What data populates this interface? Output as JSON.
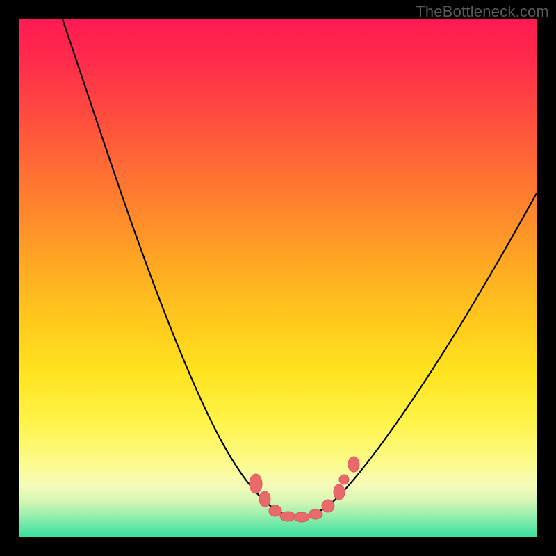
{
  "watermark": "TheBottleneck.com",
  "chart_data": {
    "type": "line",
    "title": "",
    "xlabel": "",
    "ylabel": "",
    "x_range": [
      0,
      100
    ],
    "y_range": [
      0,
      100
    ],
    "series": [
      {
        "name": "bottleneck-curve",
        "x": [
          8,
          12,
          18,
          24,
          30,
          36,
          42,
          47,
          50,
          53,
          56,
          60,
          66,
          74,
          82,
          90,
          100
        ],
        "y": [
          100,
          90,
          76,
          62,
          48,
          34,
          20,
          10,
          4,
          2,
          4,
          10,
          20,
          34,
          48,
          58,
          70
        ]
      }
    ],
    "markers": {
      "name": "highlight-points",
      "x": [
        45,
        47,
        49,
        51,
        53,
        55,
        57,
        59,
        62
      ],
      "y": [
        13,
        8,
        4,
        2,
        2,
        4,
        8,
        13,
        19
      ]
    },
    "gradient_stops": [
      {
        "pos": 0.0,
        "color": "#ff1a52"
      },
      {
        "pos": 0.5,
        "color": "#ffc81d"
      },
      {
        "pos": 0.85,
        "color": "#fcfb8e"
      },
      {
        "pos": 1.0,
        "color": "#37e19f"
      }
    ]
  }
}
